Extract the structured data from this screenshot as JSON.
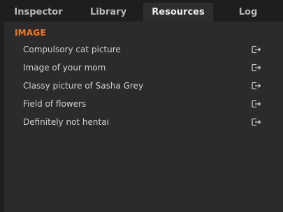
{
  "tabs": [
    {
      "label": "Inspector"
    },
    {
      "label": "Library"
    },
    {
      "label": "Resources"
    },
    {
      "label": "Log"
    }
  ],
  "active_tab": "Resources",
  "section": {
    "title": "IMAGE"
  },
  "items": [
    {
      "label": "Compulsory cat picture",
      "icon": "open-external-icon"
    },
    {
      "label": "Image of your mom",
      "icon": "open-external-icon"
    },
    {
      "label": "Classy picture of Sasha Grey",
      "icon": "open-external-icon"
    },
    {
      "label": "Field of flowers",
      "icon": "open-external-icon"
    },
    {
      "label": "Definitely not hentai",
      "icon": "open-external-icon"
    }
  ],
  "colors": {
    "background": "#1e1e1e",
    "panel": "#2b2b2b",
    "active_tab": "#2e2e2e",
    "section_title": "#f07a1a",
    "text": "#d0d0d0"
  }
}
